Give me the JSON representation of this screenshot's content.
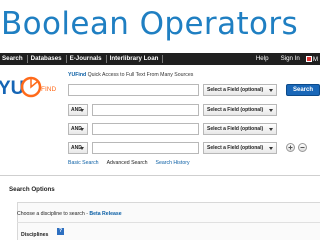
{
  "slide": {
    "title": "Boolean Operators"
  },
  "navbar": {
    "items": [
      "Search",
      "Databases",
      "E-Journals",
      "Interlibrary Loan"
    ],
    "right_items": [
      "Help",
      "Sign In"
    ],
    "flag_text": "M",
    "background": "#1f1f1f"
  },
  "logo": {
    "text": "FIND",
    "color": "#ff6a1a"
  },
  "tagline": {
    "brand": "YUFind",
    "text": " Quick Access to Full Text From Many Sources"
  },
  "search": {
    "rows": [
      {
        "operator": "",
        "value": "",
        "field": "Select a Field (optional)"
      },
      {
        "operator": "AND",
        "value": "",
        "field": "Select a Field (optional)"
      },
      {
        "operator": "AND",
        "value": "",
        "field": "Select a Field (optional)"
      },
      {
        "operator": "AND",
        "value": "",
        "field": "Select a Field (optional)"
      }
    ],
    "button_label": "Search",
    "button_color": "#1967b8",
    "add_row_icon": "plus-icon",
    "remove_row_icon": "minus-icon"
  },
  "links": [
    "Basic Search",
    "Advanced Search",
    "Search History"
  ],
  "options": {
    "header": "Search Options",
    "discipline_prompt": "Choose a discipline to search - ",
    "beta_label": "Beta Release",
    "disciplines_label": "Disciplines",
    "help_label": "?"
  },
  "colors": {
    "accent": "#1f7fc2",
    "link": "#0b5fa5"
  }
}
